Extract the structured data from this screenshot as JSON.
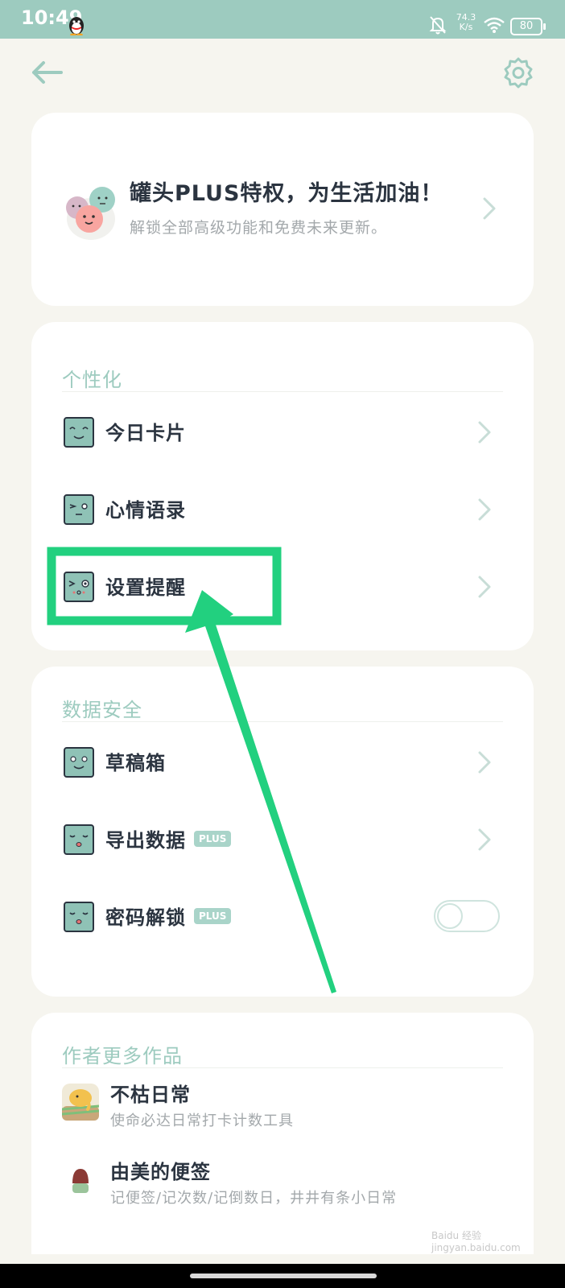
{
  "status_bar": {
    "time": "10:49",
    "net_speed_value": "74.3",
    "net_speed_unit": "K/s",
    "battery": "80",
    "icons": [
      "qq-icon",
      "bell-off-icon",
      "wifi-icon",
      "battery-icon"
    ]
  },
  "topbar": {
    "back_icon": "arrow-left-icon",
    "settings_icon": "gear-icon"
  },
  "plus_card": {
    "title": "罐头PLUS特权，为生活加油！",
    "subtitle": "解锁全部高级功能和免费未来更新。"
  },
  "personalization": {
    "title": "个性化",
    "items": [
      {
        "label": "今日卡片"
      },
      {
        "label": "心情语录"
      },
      {
        "label": "设置提醒"
      }
    ]
  },
  "data_security": {
    "title": "数据安全",
    "items": [
      {
        "label": "草稿箱"
      },
      {
        "label": "导出数据",
        "badge": "PLUS"
      },
      {
        "label": "密码解锁",
        "badge": "PLUS",
        "toggle_on": false
      }
    ]
  },
  "more_works": {
    "title": "作者更多作品",
    "apps": [
      {
        "name": "不枯日常",
        "desc": "使命必达日常打卡计数工具"
      },
      {
        "name": "由美的便签",
        "desc": "记便签/记次数/记倒数日，井井有条小日常"
      }
    ]
  },
  "watermark": "Baidu 经验 jingyan.baidu.com",
  "colors": {
    "accent": "#9dcbbf",
    "face_green": "#8fc2b6",
    "annotation_green": "#22d07f",
    "background": "#f6f5ef"
  }
}
